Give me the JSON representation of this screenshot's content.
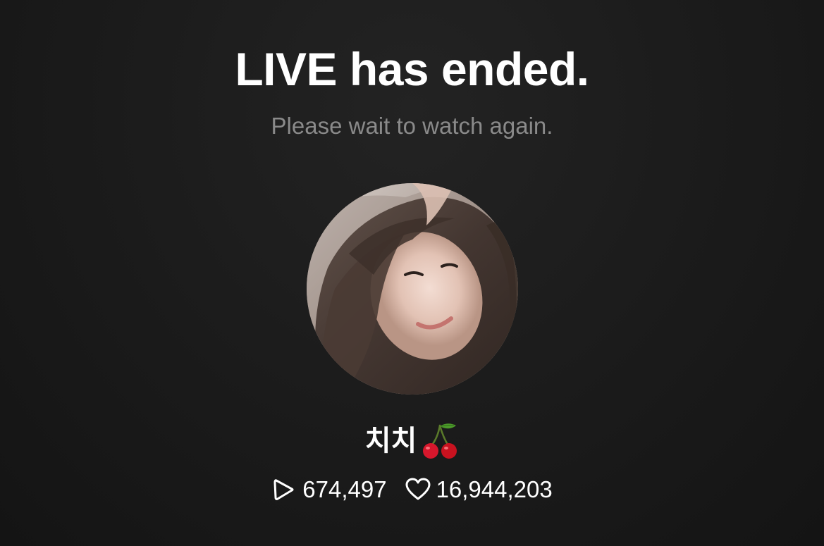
{
  "header": {
    "title": "LIVE has ended.",
    "subtitle": "Please wait to watch again."
  },
  "profile": {
    "name": "치치",
    "name_emoji_icon": "cherry-icon"
  },
  "stats": {
    "plays": {
      "icon": "play-icon",
      "value": "674,497"
    },
    "likes": {
      "icon": "heart-icon",
      "value": "16,944,203"
    }
  },
  "colors": {
    "background": "#1c1c1c",
    "title": "#ffffff",
    "subtitle": "#8a8a8a",
    "cherry": "#d6172c",
    "leaf": "#4c9a2a"
  }
}
